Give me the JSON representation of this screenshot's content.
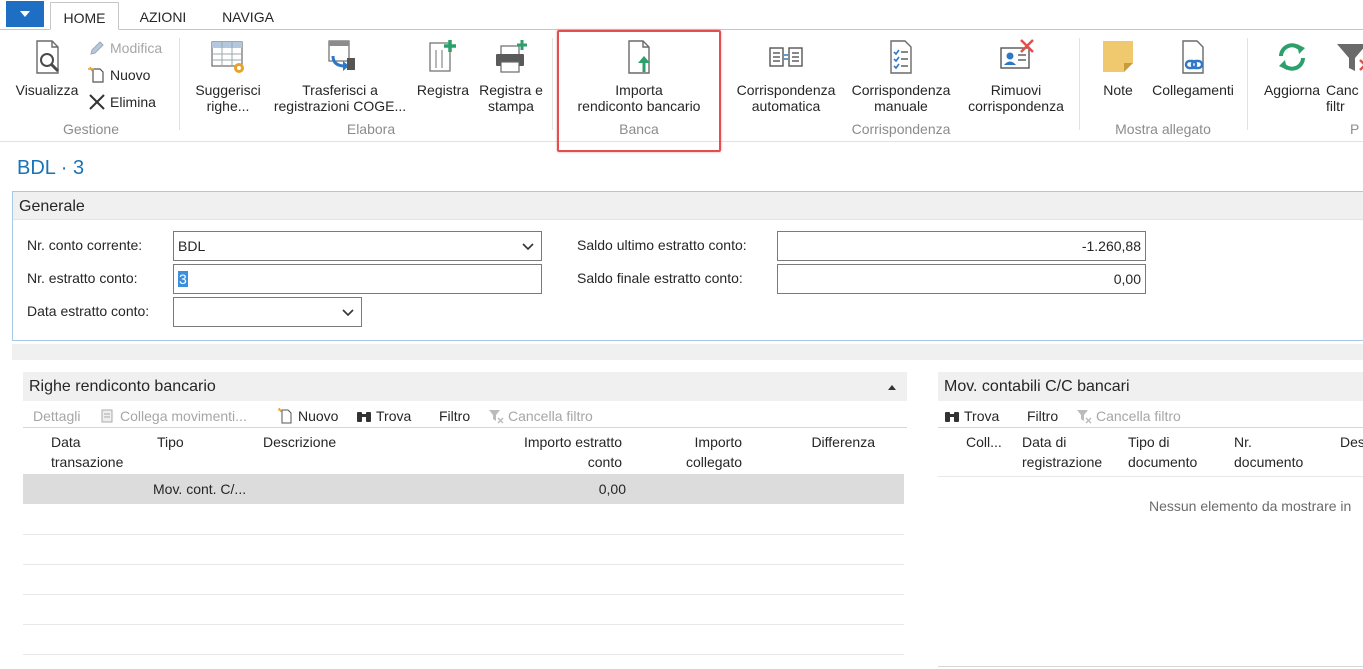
{
  "tabs": [
    {
      "label": "HOME",
      "active": true
    },
    {
      "label": "AZIONI",
      "active": false
    },
    {
      "label": "NAVIGA",
      "active": false
    }
  ],
  "app_menu_icon": "dropdown-triangle-icon",
  "ribbon": {
    "gestione": {
      "label": "Gestione",
      "visualizza": "Visualizza",
      "modifica": "Modifica",
      "nuovo": "Nuovo",
      "elimina": "Elimina"
    },
    "elabora": {
      "label": "Elabora",
      "suggerisci_1": "Suggerisci",
      "suggerisci_2": "righe...",
      "trasferisci_1": "Trasferisci a",
      "trasferisci_2": "registrazioni COGE...",
      "registra": "Registra",
      "registra_stampa_1": "Registra e",
      "registra_stampa_2": "stampa"
    },
    "banca": {
      "label": "Banca",
      "importa_1": "Importa",
      "importa_2": "rendiconto bancario"
    },
    "corrispondenza": {
      "label": "Corrispondenza",
      "auto_1": "Corrispondenza",
      "auto_2": "automatica",
      "manuale_1": "Corrispondenza",
      "manuale_2": "manuale",
      "rimuovi_1": "Rimuovi",
      "rimuovi_2": "corrispondenza"
    },
    "allegato": {
      "label": "Mostra allegato",
      "note": "Note",
      "collegamenti": "Collegamenti"
    },
    "pagina": {
      "label": "P",
      "aggiorna": "Aggiorna",
      "cancella_1": "Canc",
      "cancella_2": "filtr"
    }
  },
  "page_title": "BDL · 3",
  "generale": {
    "title": "Generale",
    "nr_conto_label": "Nr. conto corrente:",
    "nr_conto_value": "BDL",
    "nr_estratto_label": "Nr. estratto conto:",
    "nr_estratto_value": "3",
    "data_estratto_label": "Data estratto conto:",
    "data_estratto_value": "",
    "saldo_ultimo_label": "Saldo ultimo estratto conto:",
    "saldo_ultimo_value": "-1.260,88",
    "saldo_finale_label": "Saldo finale estratto conto:",
    "saldo_finale_value": "0,00"
  },
  "righe": {
    "title": "Righe rendiconto bancario",
    "tools": {
      "dettagli": "Dettagli",
      "collega": "Collega movimenti...",
      "nuovo": "Nuovo",
      "trova": "Trova",
      "filtro": "Filtro",
      "cancella_filtro": "Cancella filtro"
    },
    "columns": {
      "data_1": "Data",
      "data_2": "transazione",
      "tipo": "Tipo",
      "descrizione": "Descrizione",
      "importo_1": "Importo estratto",
      "importo_2": "conto",
      "collegato_1": "Importo",
      "collegato_2": "collegato",
      "differenza": "Differenza"
    },
    "rows": [
      {
        "data": "",
        "tipo": "Mov. cont. C/...",
        "descrizione": "",
        "importo": "0,00",
        "collegato": "",
        "differenza": ""
      }
    ]
  },
  "movimenti": {
    "title": "Mov. contabili C/C bancari",
    "tools": {
      "trova": "Trova",
      "filtro": "Filtro",
      "cancella_filtro": "Cancella filtro"
    },
    "columns": {
      "coll": "Coll...",
      "data_1": "Data di",
      "data_2": "registrazione",
      "tipo_1": "Tipo di",
      "tipo_2": "documento",
      "nr_1": "Nr.",
      "nr_2": "documento",
      "des": "Des"
    },
    "empty": "Nessun elemento da mostrare in"
  }
}
